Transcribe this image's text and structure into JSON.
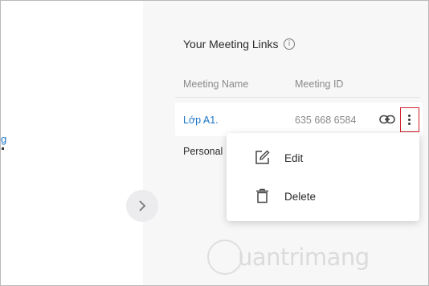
{
  "left_panel": {
    "link_fragment": "g"
  },
  "header": {
    "title": "Your Meeting Links",
    "info_icon": "info-icon"
  },
  "table": {
    "columns": [
      "Meeting Name",
      "Meeting ID"
    ],
    "rows": [
      {
        "name": "Lớp A1.",
        "meeting_id": "635 668 6584"
      },
      {
        "name": "Personal M"
      }
    ]
  },
  "context_menu": {
    "items": [
      {
        "label": "Edit",
        "icon": "edit-icon"
      },
      {
        "label": "Delete",
        "icon": "trash-icon"
      }
    ]
  },
  "colors": {
    "link": "#1a73c8",
    "highlight_border": "#d0202a",
    "panel_bg": "#f7f7f8"
  },
  "watermark": {
    "text": "uantrimang"
  }
}
